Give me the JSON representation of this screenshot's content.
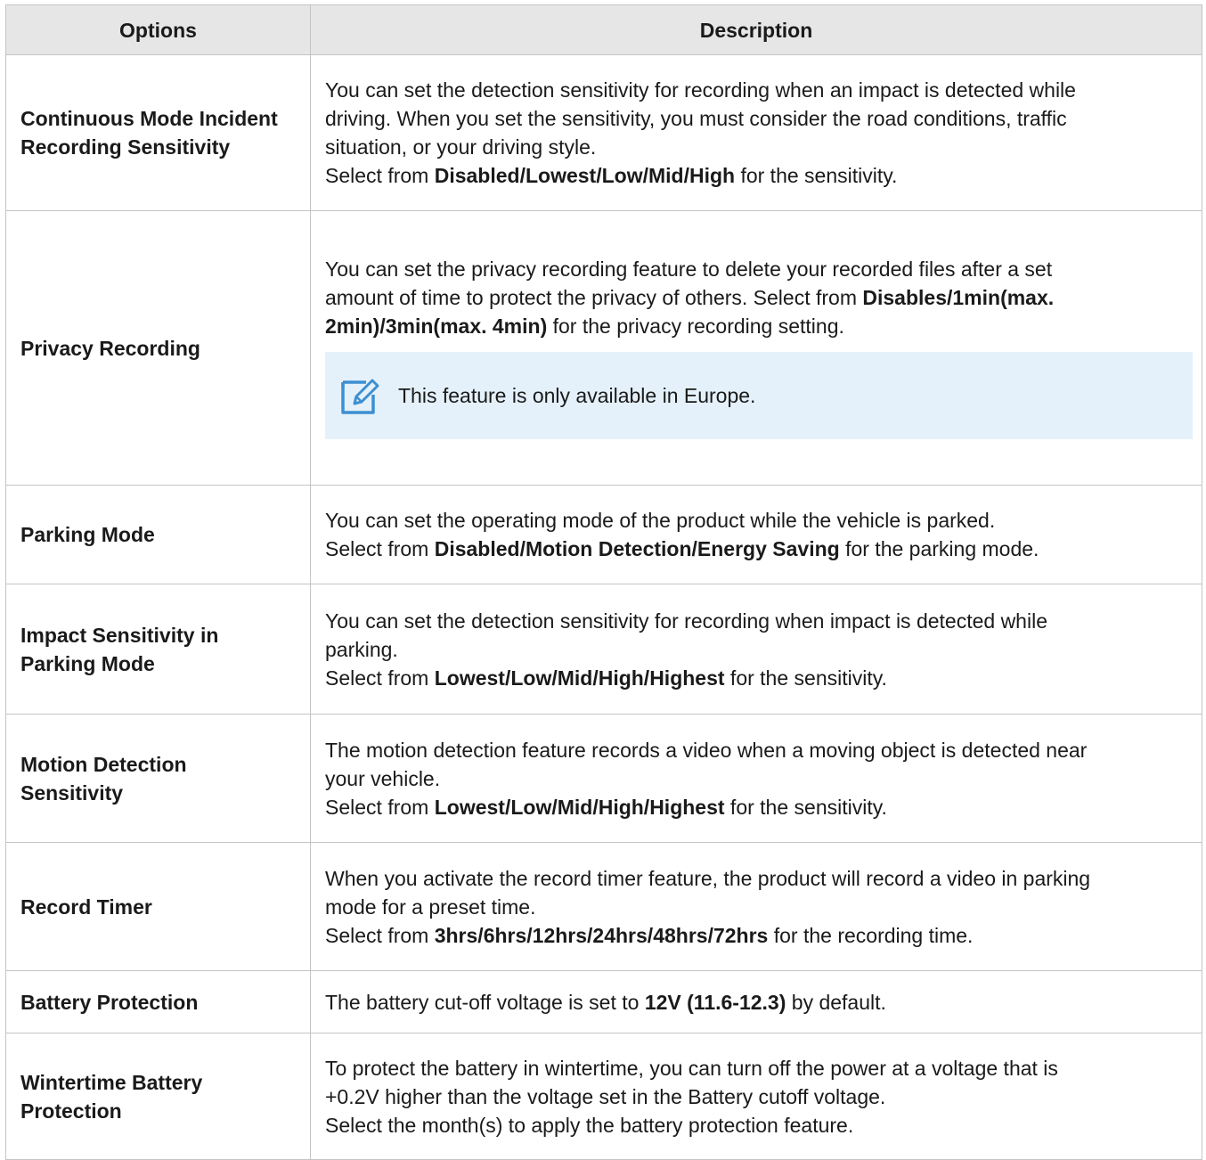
{
  "headers": {
    "options": "Options",
    "description": "Description"
  },
  "rows": [
    {
      "option": [
        "Continuous Mode Incident",
        "Recording Sensitivity"
      ],
      "desc_lines": [
        "You can set the detection sensitivity for recording when an impact is detected while",
        "driving. When you set the sensitivity, you must consider the road conditions, traffic",
        "situation, or your driving style."
      ],
      "select": {
        "pre": "Select from ",
        "bold": "Disabled/Lowest/Low/Mid/High",
        "post": " for the sensitivity."
      }
    },
    {
      "option": [
        "Privacy Recording"
      ],
      "desc_lines": [
        "You can set the privacy recording feature to delete your recorded files after a set"
      ],
      "mixed": {
        "line2_pre": "amount of time to protect the privacy of others. Select from ",
        "line2_bold": "Disables/1min(max.",
        "line3_bold": "2min)/3min(max. 4min)",
        "line3_post": " for the privacy recording setting."
      },
      "note": {
        "icon": "note-pencil-icon",
        "text": "This feature is only available in Europe."
      }
    },
    {
      "option": [
        "Parking Mode"
      ],
      "desc_lines": [
        "You can set the operating mode of the product while the vehicle is parked."
      ],
      "select": {
        "pre": "Select from ",
        "bold": "Disabled/Motion Detection/Energy Saving",
        "post": " for the parking mode."
      }
    },
    {
      "option": [
        "Impact Sensitivity in",
        "Parking Mode"
      ],
      "desc_lines": [
        "You can set the detection sensitivity for recording when impact is detected while",
        "parking."
      ],
      "select": {
        "pre": "Select from ",
        "bold": "Lowest/Low/Mid/High/Highest",
        "post": " for the sensitivity."
      }
    },
    {
      "option": [
        "Motion Detection",
        "Sensitivity"
      ],
      "desc_lines": [
        "The motion detection feature records a video when a moving object is detected near",
        "your vehicle."
      ],
      "select": {
        "pre": "Select from ",
        "bold": "Lowest/Low/Mid/High/Highest",
        "post": " for the sensitivity."
      }
    },
    {
      "option": [
        "Record Timer"
      ],
      "desc_lines": [
        "When you activate the record timer feature, the product will record a video in parking",
        "mode for a preset time."
      ],
      "select": {
        "pre": "Select from ",
        "bold": "3hrs/6hrs/12hrs/24hrs/48hrs/72hrs",
        "post": " for the recording time."
      }
    },
    {
      "option": [
        "Battery Protection"
      ],
      "desc_lines": [],
      "select": {
        "pre": "The battery cut-off voltage is set to ",
        "bold": "12V (11.6-12.3)",
        "post": " by default."
      }
    },
    {
      "option": [
        "Wintertime Battery",
        "Protection"
      ],
      "desc_lines": [
        "To protect the battery in wintertime, you can turn off the power at a voltage that is",
        "+0.2V higher than the voltage set in the Battery cutoff voltage.",
        "Select the month(s) to apply the battery protection feature."
      ]
    }
  ],
  "colors": {
    "header_bg": "#e6e6e6",
    "border": "#c4c4c4",
    "note_bg": "#e5f1fa",
    "note_icon": "#3d8fd1"
  }
}
